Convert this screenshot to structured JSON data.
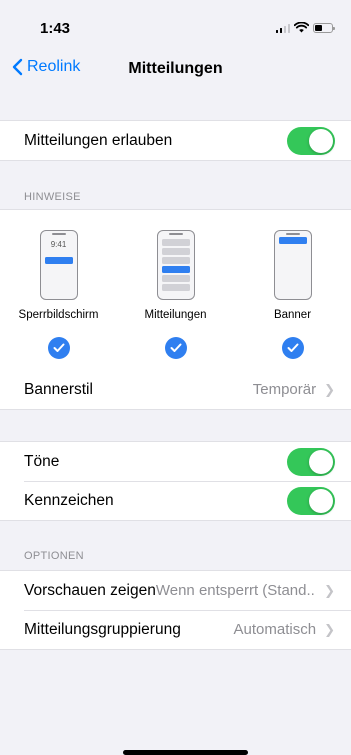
{
  "status": {
    "time": "1:43"
  },
  "nav": {
    "back_label": "Reolink",
    "title": "Mitteilungen"
  },
  "allow": {
    "label": "Mitteilungen erlauben",
    "on": true
  },
  "hinweise": {
    "header": "HINWEISE",
    "lock_time": "9:41",
    "styles": [
      {
        "label": "Sperrbildschirm",
        "checked": true
      },
      {
        "label": "Mitteilungen",
        "checked": true
      },
      {
        "label": "Banner",
        "checked": true
      }
    ],
    "bannerstil": {
      "label": "Bannerstil",
      "value": "Temporär"
    }
  },
  "sounds": {
    "toene": {
      "label": "Töne",
      "on": true
    },
    "badges": {
      "label": "Kennzeichen",
      "on": true
    }
  },
  "optionen": {
    "header": "OPTIONEN",
    "preview": {
      "label": "Vorschauen zeigen",
      "value": "Wenn entsperrt (Stand..."
    },
    "grouping": {
      "label": "Mitteilungsgruppierung",
      "value": "Automatisch"
    }
  },
  "colors": {
    "accent": "#007aff",
    "toggle_on": "#34c759",
    "check": "#2f7ff0",
    "banner": "#2f7ff0"
  }
}
